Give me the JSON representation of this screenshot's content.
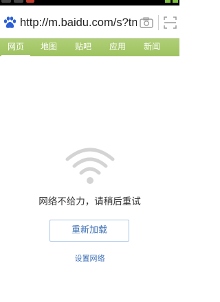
{
  "address_bar": {
    "url": "http://m.baidu.com/s?tn",
    "logo_icon": "baidu-paw-icon",
    "camera_icon": "camera-icon",
    "scan_icon": "scan-icon"
  },
  "tabs": [
    {
      "label": "网页",
      "active": true
    },
    {
      "label": "地图",
      "active": false
    },
    {
      "label": "贴吧",
      "active": false
    },
    {
      "label": "应用",
      "active": false
    },
    {
      "label": "新闻",
      "active": false
    }
  ],
  "error": {
    "icon": "wifi-icon",
    "message": "网络不给力，请稍后重试",
    "reload_label": "重新加载",
    "settings_label": "设置网络"
  },
  "colors": {
    "tab_bar": "#a8c96b",
    "link": "#3c6fb5",
    "wifi_gray": "#d4d4d4",
    "baidu_blue": "#2c5fd4"
  }
}
